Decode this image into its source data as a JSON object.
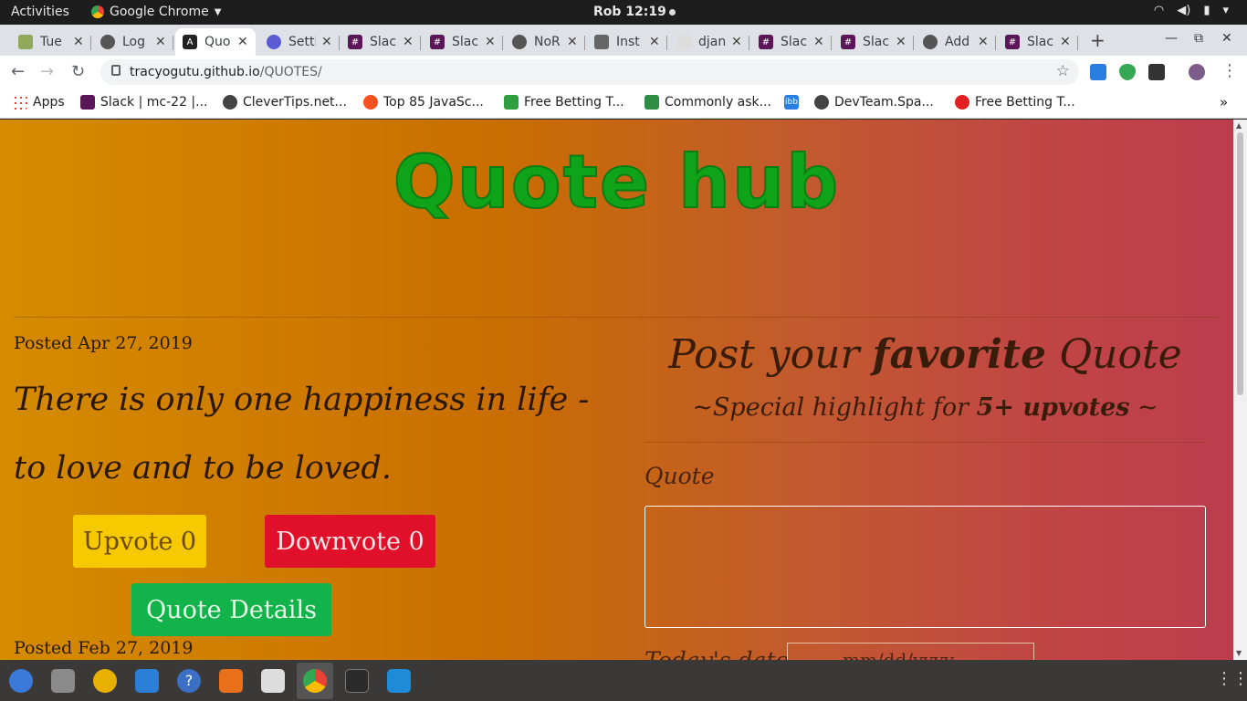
{
  "system": {
    "activities": "Activities",
    "app_name": "Google Chrome",
    "clock": "Rob 12:19"
  },
  "tabs": [
    {
      "label": "Tue",
      "color": "#8fa85a"
    },
    {
      "label": "Log",
      "color": "#555555"
    },
    {
      "label": "Quo",
      "color": "#222222"
    },
    {
      "label": "Setti",
      "color": "#5b5bd6"
    },
    {
      "label": "Slac",
      "color": "#5a1657"
    },
    {
      "label": "Slac",
      "color": "#5a1657"
    },
    {
      "label": "NoR",
      "color": "#555555"
    },
    {
      "label": "Inst",
      "color": "#666666"
    },
    {
      "label": "djan",
      "color": "#dddddd"
    },
    {
      "label": "Slac",
      "color": "#5a1657"
    },
    {
      "label": "Slac",
      "color": "#5a1657"
    },
    {
      "label": "Add",
      "color": "#555555"
    },
    {
      "label": "Slac",
      "color": "#5a1657"
    }
  ],
  "address": {
    "domain": "tracyogutu.github.io",
    "path": "/QUOTES/"
  },
  "bookmarks": [
    {
      "label": "Apps",
      "color": "#e94235"
    },
    {
      "label": "Slack | mc-22 |...",
      "color": "#5a1657"
    },
    {
      "label": "CleverTips.net...",
      "color": "#444444"
    },
    {
      "label": "Top 85 JavaSc...",
      "color": "#f4511e"
    },
    {
      "label": "Free Betting T...",
      "color": "#2e9f3e"
    },
    {
      "label": "Commonly ask...",
      "color": "#2f8d46"
    },
    {
      "label": "ibb",
      "color": "#2a7de1"
    },
    {
      "label": "DevTeam.Spa...",
      "color": "#444444"
    },
    {
      "label": "Free Betting T...",
      "color": "#e02020"
    }
  ],
  "page": {
    "title": "Quote hub",
    "quotes": [
      {
        "posted": "Posted Apr 27, 2019",
        "text": "There is only one happiness in life - to love and to be loved.",
        "upvote_label": "Upvote 0",
        "downvote_label": "Downvote 0",
        "details_label": "Quote Details"
      },
      {
        "posted": "Posted Feb 27, 2019"
      }
    ],
    "form": {
      "title_pre": "Post your ",
      "title_bold": "favorite",
      "title_post": " Quote",
      "sub_pre": "~Special highlight for ",
      "sub_bold": "5+ upvotes",
      "sub_post": " ~",
      "quote_label": "Quote",
      "date_label": "Today's date",
      "date_value": "mm/dd/yyyy"
    }
  },
  "dock": [
    {
      "name": "thunderbird-icon",
      "color": "#3b7ad9"
    },
    {
      "name": "files-icon",
      "color": "#8a8a8a"
    },
    {
      "name": "rhythmbox-icon",
      "color": "#e8b000"
    },
    {
      "name": "writer-icon",
      "color": "#2b7fd6"
    },
    {
      "name": "help-icon",
      "color": "#3a6fc4"
    },
    {
      "name": "software-icon",
      "color": "#e8701a"
    },
    {
      "name": "amazon-icon",
      "color": "#dddddd"
    },
    {
      "name": "chrome-icon",
      "color": "#e94235"
    },
    {
      "name": "terminal-icon",
      "color": "#2b2b2b"
    },
    {
      "name": "vscode-icon",
      "color": "#1f8ad8"
    }
  ]
}
